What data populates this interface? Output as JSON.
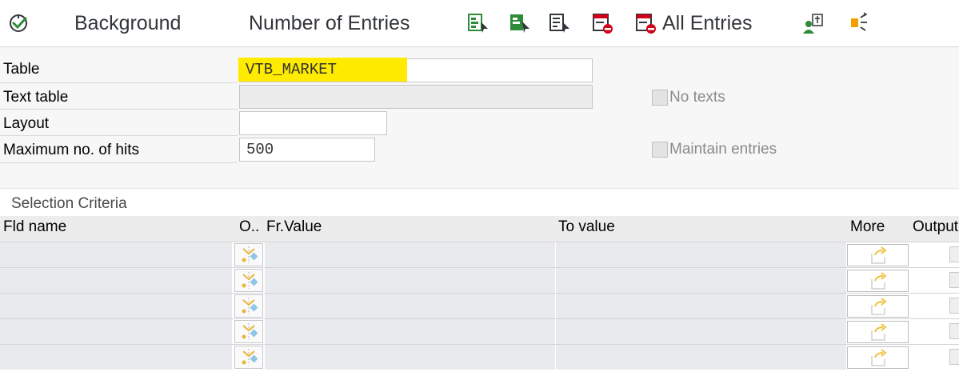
{
  "toolbar": {
    "background_label": "Background",
    "number_of_entries_label": "Number of Entries",
    "all_entries_label": "All Entries",
    "icons": [
      "execute-icon",
      "list-select-icon",
      "list-select-icon",
      "list-select-icon",
      "list-delete-icon",
      "all-entries-icon",
      "user-settings-icon",
      "hierarchy-icon"
    ]
  },
  "form": {
    "table_label": "Table",
    "table_value": "VTB_MARKET",
    "text_table_label": "Text table",
    "text_table_value": "",
    "layout_label": "Layout",
    "layout_value": "",
    "max_hits_label": "Maximum no. of hits",
    "max_hits_value": "500",
    "no_texts_label": "No texts",
    "maintain_entries_label": "Maintain entries"
  },
  "selection": {
    "title": "Selection Criteria",
    "columns": {
      "fld_name": "Fld name",
      "option": "O..",
      "from_value": "Fr.Value",
      "to_value": "To value",
      "more": "More",
      "output": "Output"
    },
    "rows": [
      {
        "fld_name": "",
        "from_value": "",
        "to_value": ""
      },
      {
        "fld_name": "",
        "from_value": "",
        "to_value": ""
      },
      {
        "fld_name": "",
        "from_value": "",
        "to_value": ""
      },
      {
        "fld_name": "",
        "from_value": "",
        "to_value": ""
      },
      {
        "fld_name": "",
        "from_value": "",
        "to_value": ""
      }
    ]
  },
  "colors": {
    "highlight": "#ffeb00",
    "icon_green": "#2e8b3a",
    "icon_red": "#d0021b",
    "icon_orange": "#f2a000"
  }
}
